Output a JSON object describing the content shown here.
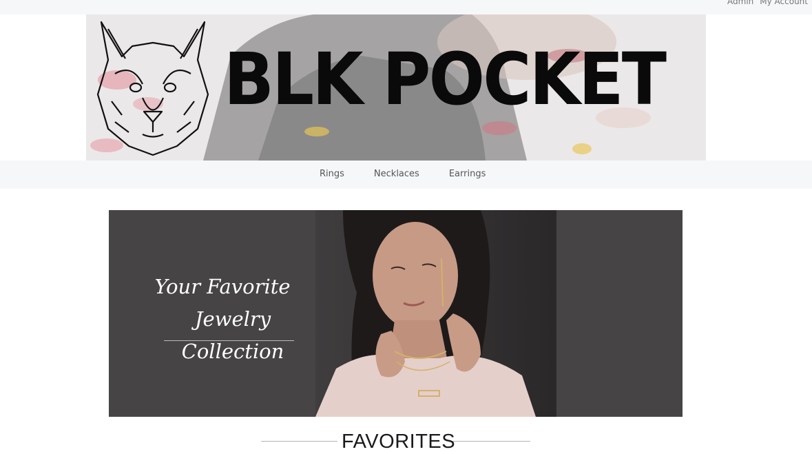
{
  "topbar": {
    "links": [
      "Admin",
      "My Account"
    ]
  },
  "banner": {
    "brand_text": "BLK POCKET",
    "logo_icon": "wolf-head-icon"
  },
  "nav": {
    "items": [
      {
        "label": "Rings"
      },
      {
        "label": "Necklaces"
      },
      {
        "label": "Earrings"
      }
    ]
  },
  "hero": {
    "tagline_line1": "Your Favorite",
    "tagline_line2": "Jewelry Collection",
    "background": "#464445"
  },
  "section": {
    "title": "FAVORITES"
  }
}
